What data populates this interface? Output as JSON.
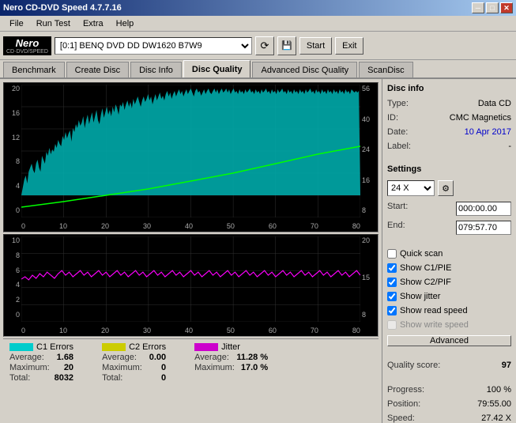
{
  "app": {
    "title": "Nero CD-DVD Speed 4.7.7.16",
    "drive_label": "[0:1]  BENQ DVD DD DW1620 B7W9"
  },
  "menu": {
    "items": [
      "File",
      "Run Test",
      "Extra",
      "Help"
    ]
  },
  "toolbar": {
    "start_label": "Start",
    "exit_label": "Exit"
  },
  "tabs": [
    {
      "label": "Benchmark",
      "active": false
    },
    {
      "label": "Create Disc",
      "active": false
    },
    {
      "label": "Disc Info",
      "active": false
    },
    {
      "label": "Disc Quality",
      "active": true
    },
    {
      "label": "Advanced Disc Quality",
      "active": false
    },
    {
      "label": "ScanDisc",
      "active": false
    }
  ],
  "disc_info": {
    "section_title": "Disc info",
    "type_label": "Type:",
    "type_value": "Data CD",
    "id_label": "ID:",
    "id_value": "CMC Magnetics",
    "date_label": "Date:",
    "date_value": "10 Apr 2017",
    "label_label": "Label:",
    "label_value": "-"
  },
  "settings": {
    "section_title": "Settings",
    "speed_value": "24 X",
    "start_label": "Start:",
    "start_value": "000:00.00",
    "end_label": "End:",
    "end_value": "079:57.70"
  },
  "checkboxes": [
    {
      "label": "Quick scan",
      "checked": false,
      "disabled": false
    },
    {
      "label": "Show C1/PIE",
      "checked": true,
      "disabled": false
    },
    {
      "label": "Show C2/PIF",
      "checked": true,
      "disabled": false
    },
    {
      "label": "Show jitter",
      "checked": true,
      "disabled": false
    },
    {
      "label": "Show read speed",
      "checked": true,
      "disabled": false
    },
    {
      "label": "Show write speed",
      "checked": false,
      "disabled": true
    }
  ],
  "advanced_btn": "Advanced",
  "quality": {
    "score_label": "Quality score:",
    "score_value": "97"
  },
  "progress": {
    "progress_label": "Progress:",
    "progress_value": "100 %",
    "position_label": "Position:",
    "position_value": "79:55.00",
    "speed_label": "Speed:",
    "speed_value": "27.42 X"
  },
  "legend": {
    "c1": {
      "label": "C1 Errors",
      "color": "#00cccc",
      "avg_label": "Average:",
      "avg_value": "1.68",
      "max_label": "Maximum:",
      "max_value": "20",
      "total_label": "Total:",
      "total_value": "8032"
    },
    "c2": {
      "label": "C2 Errors",
      "color": "#cccc00",
      "avg_label": "Average:",
      "avg_value": "0.00",
      "max_label": "Maximum:",
      "max_value": "0",
      "total_label": "Total:",
      "total_value": "0"
    },
    "jitter": {
      "label": "Jitter",
      "color": "#cc00cc",
      "avg_label": "Average:",
      "avg_value": "11.28 %",
      "max_label": "Maximum:",
      "max_value": "17.0 %"
    }
  },
  "chart_top": {
    "y_left": [
      "20",
      "16",
      "12",
      "8",
      "4",
      "0"
    ],
    "y_right": [
      "56",
      "40",
      "24",
      "16",
      "8"
    ],
    "x": [
      "0",
      "10",
      "20",
      "30",
      "40",
      "50",
      "60",
      "70",
      "80"
    ]
  },
  "chart_bottom": {
    "y_left": [
      "10",
      "8",
      "6",
      "4",
      "2",
      "0"
    ],
    "y_right": [
      "20",
      "15",
      "8"
    ],
    "x": [
      "0",
      "10",
      "20",
      "30",
      "40",
      "50",
      "60",
      "70",
      "80"
    ]
  }
}
